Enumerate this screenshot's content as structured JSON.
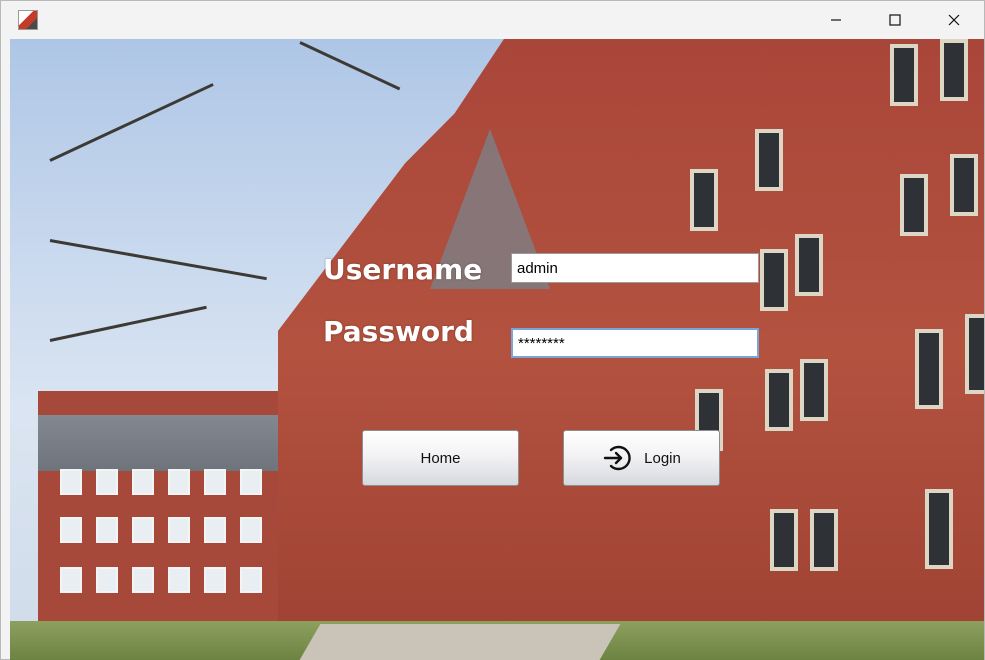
{
  "window": {
    "controls": {
      "minimize_icon": "minimize-icon",
      "maximize_icon": "maximize-icon",
      "close_icon": "close-icon"
    }
  },
  "form": {
    "username_label": "Username",
    "username_value": "admin",
    "password_label": "Password",
    "password_value": "********"
  },
  "buttons": {
    "home_label": "Home",
    "login_label": "Login",
    "login_icon": "sign-in-icon"
  }
}
